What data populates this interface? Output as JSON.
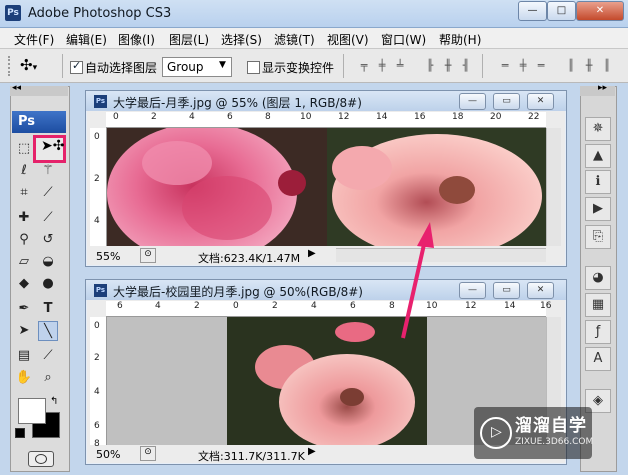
{
  "app": {
    "logo": "Ps",
    "title": "Adobe Photoshop CS3"
  },
  "window_controls": {
    "minimize": "—",
    "maximize": "□",
    "close": "✕"
  },
  "menu": [
    "文件(F)",
    "编辑(E)",
    "图像(I)",
    "图层(L)",
    "选择(S)",
    "滤镜(T)",
    "视图(V)",
    "窗口(W)",
    "帮助(H)"
  ],
  "options": {
    "tool_icon": "move-tool-icon",
    "auto_select_label": "自动选择图层",
    "auto_select_checked": true,
    "select_value": "Group",
    "show_transform_label": "显示变换控件",
    "show_transform_checked": false
  },
  "toolbox": {
    "badge": "Ps"
  },
  "doc1": {
    "icon": "Ps",
    "title": "大学最后-月季.jpg @ 55% (图层 1, RGB/8#)",
    "ruler_h": [
      "0",
      "2",
      "4",
      "6",
      "8",
      "10",
      "12",
      "14",
      "16",
      "18",
      "20",
      "22"
    ],
    "ruler_v": [
      "0",
      "2",
      "4"
    ],
    "zoom": "55%",
    "doc_size": "文档:623.4K/1.47M"
  },
  "doc2": {
    "icon": "Ps",
    "title": "大学最后-校园里的月季.jpg @ 50%(RGB/8#)",
    "ruler_h": [
      "6",
      "4",
      "2",
      "0",
      "2",
      "4",
      "6",
      "8",
      "10",
      "12",
      "14",
      "16"
    ],
    "ruler_v": [
      "0",
      "2",
      "4",
      "6",
      "8"
    ],
    "zoom": "50%",
    "doc_size": "文档:311.7K/311.7K"
  },
  "watermark": {
    "title": "溜溜自学",
    "url": "ZIXUE.3D66.COM"
  },
  "colors": {
    "highlight": "#e5226a",
    "arrow": "#e8216e"
  }
}
